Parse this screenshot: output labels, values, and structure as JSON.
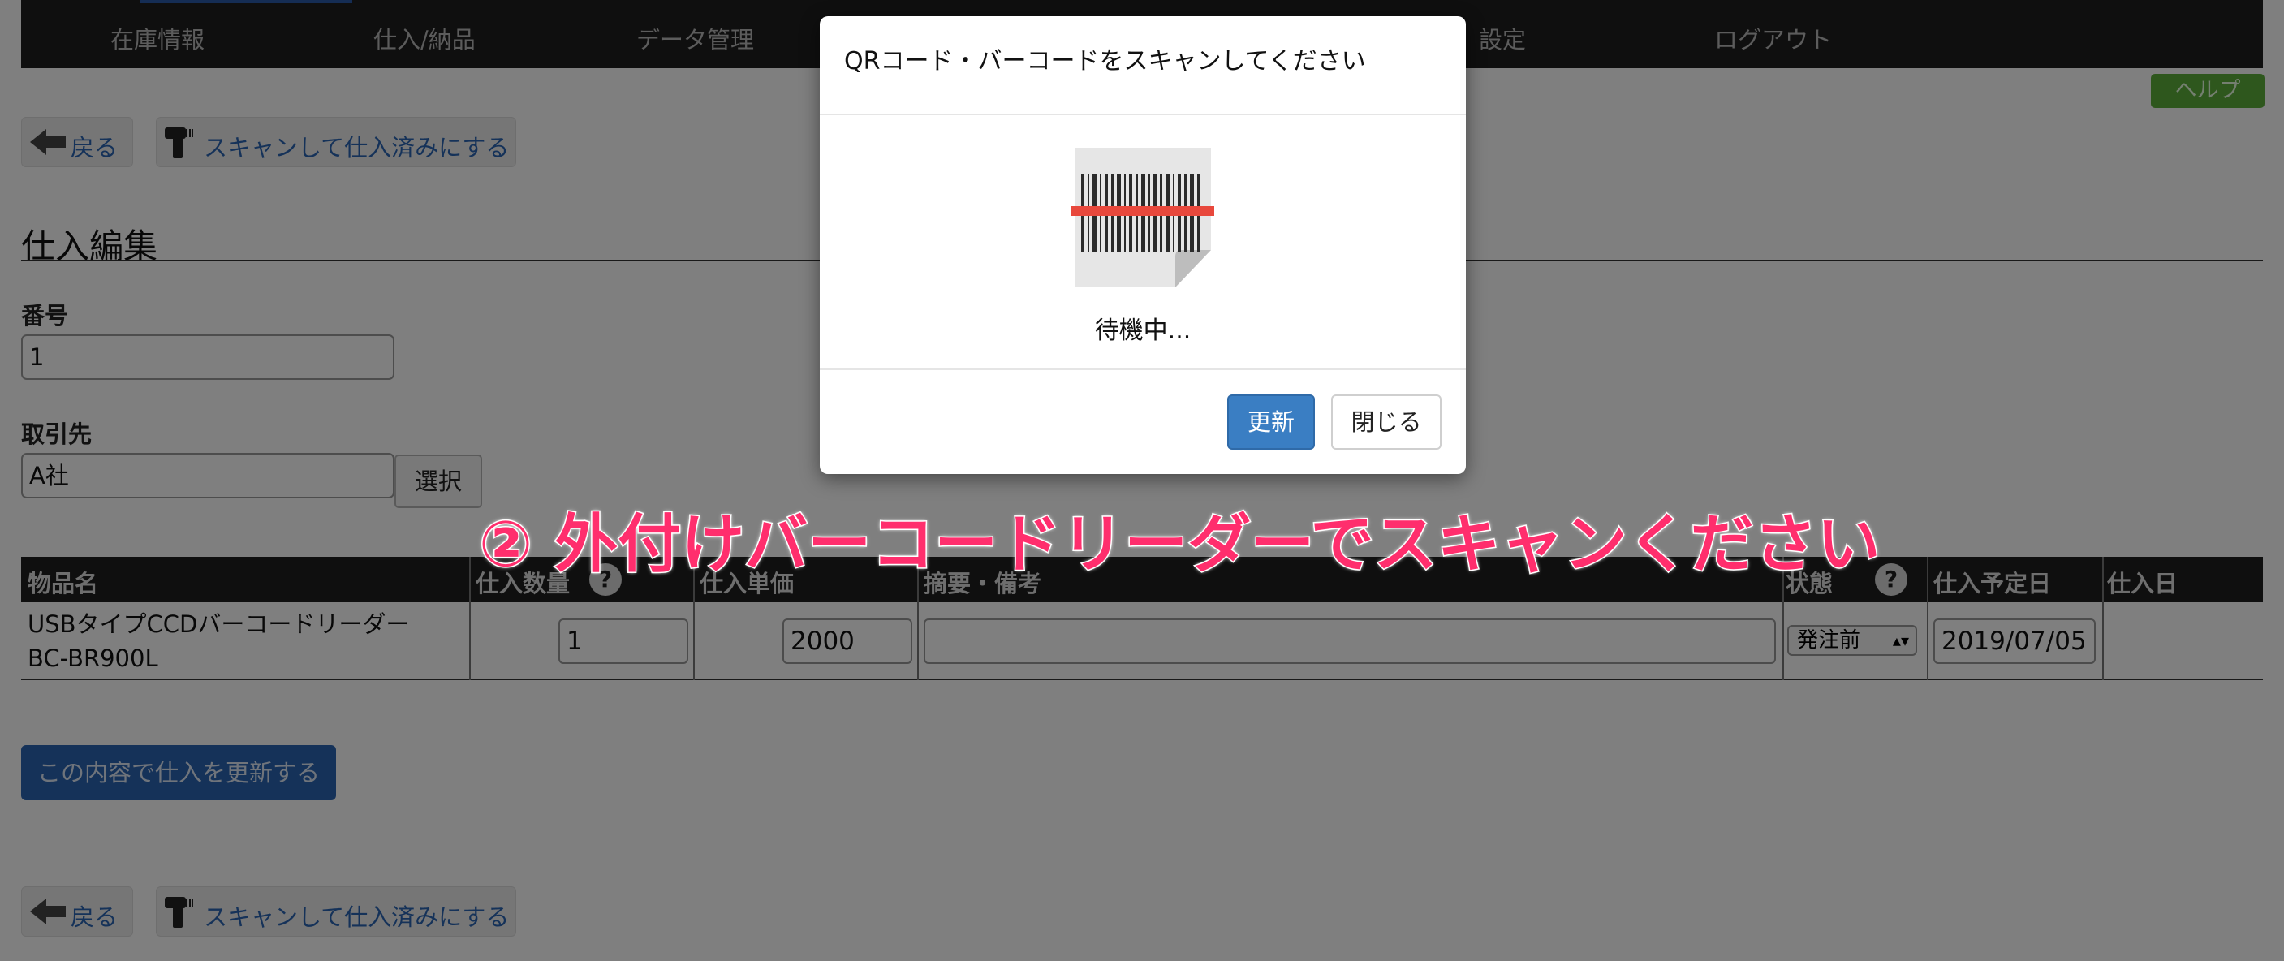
{
  "nav": {
    "items": [
      "在庫情報",
      "仕入/納品",
      "データ管理",
      "設定",
      "ログアウト"
    ],
    "help_label": "ヘルプ"
  },
  "actions": {
    "back_label": "戻る",
    "scan_label": "スキャンして仕入済みにする"
  },
  "form": {
    "title": "仕入編集",
    "number_label": "番号",
    "number_value": "1",
    "supplier_label": "取引先",
    "supplier_value": "A社",
    "select_label": "選択"
  },
  "table": {
    "headers": {
      "item_name": "物品名",
      "quantity": "仕入数量",
      "unit_price": "仕入単価",
      "memo": "摘要・備考",
      "status": "状態",
      "planned_date": "仕入予定日",
      "purchase_date": "仕入日"
    },
    "help_glyph": "?",
    "rows": [
      {
        "item_line1": "USBタイプCCDバーコードリーダー",
        "item_line2": "BC-BR900L",
        "quantity": "1",
        "unit_price": "2000",
        "memo": "",
        "status": "発注前",
        "planned_date": "2019/07/05",
        "purchase_date": ""
      }
    ]
  },
  "submit_label": "この内容で仕入を更新する",
  "modal": {
    "title": "QRコード・バーコードをスキャンしてください",
    "status": "待機中...",
    "update_label": "更新",
    "close_label": "閉じる"
  },
  "annotation": "② 外付けバーコードリーダーでスキャンください",
  "colors": {
    "nav_bg": "#1f1f1f",
    "link_blue": "#2a64b3",
    "help_green": "#5cae3a",
    "annotation_pink": "#ff2e6d",
    "scan_line_red": "#e8483c"
  }
}
